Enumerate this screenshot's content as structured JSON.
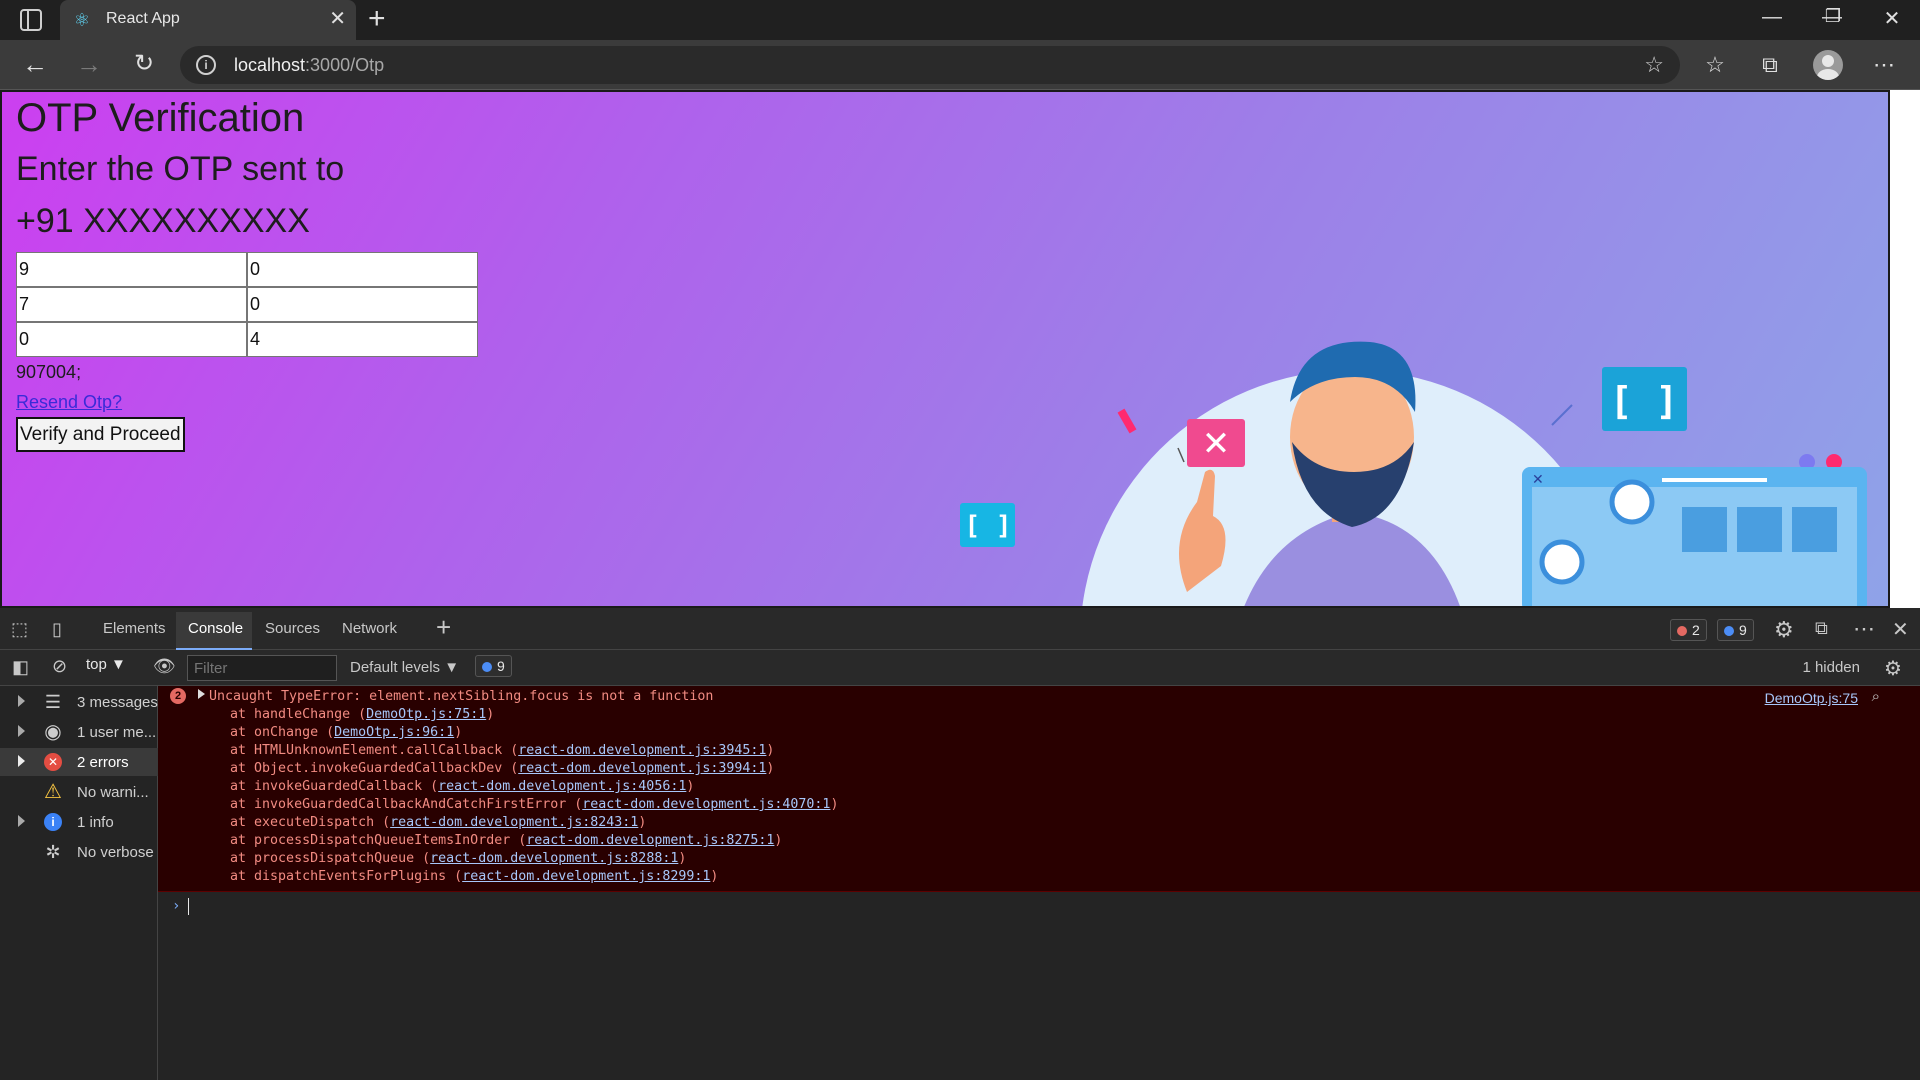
{
  "browser": {
    "tab_title": "React App",
    "url_host": "localhost",
    "url_rest": ":3000/Otp"
  },
  "page": {
    "heading": "OTP Verification",
    "subheading": "Enter the OTP sent to",
    "phone": "+91 XXXXXXXXXX",
    "otp_inputs": [
      "9",
      "0",
      "7",
      "0",
      "0",
      "4"
    ],
    "otp_value": "907004;",
    "resend_label": "Resend Otp?",
    "verify_label": "Verify and Proceed"
  },
  "devtools": {
    "tabs": [
      "Elements",
      "Console",
      "Sources",
      "Network"
    ],
    "active_tab": "Console",
    "error_count": "2",
    "info_count": "9",
    "context": "top",
    "filter_placeholder": "Filter",
    "levels_label": "Default levels",
    "issues_count": "9",
    "hidden_label": "1 hidden",
    "sidebar": [
      {
        "label": "3 messages",
        "icon": "list-icon"
      },
      {
        "label": "1 user me...",
        "icon": "user-icon"
      },
      {
        "label": "2 errors",
        "icon": "error-icon"
      },
      {
        "label": "No warni...",
        "icon": "warning-icon"
      },
      {
        "label": "1 info",
        "icon": "info-icon"
      },
      {
        "label": "No verbose",
        "icon": "bug-icon"
      }
    ],
    "error": {
      "count_badge": "2",
      "message": "Uncaught TypeError: element.nextSibling.focus is not a function",
      "source": "DemoOtp.js:75",
      "stack": [
        {
          "fn": "at handleChange (",
          "link": "DemoOtp.js:75:1"
        },
        {
          "fn": "at onChange (",
          "link": "DemoOtp.js:96:1"
        },
        {
          "fn": "at HTMLUnknownElement.callCallback (",
          "link": "react-dom.development.js:3945:1"
        },
        {
          "fn": "at Object.invokeGuardedCallbackDev (",
          "link": "react-dom.development.js:3994:1"
        },
        {
          "fn": "at invokeGuardedCallback (",
          "link": "react-dom.development.js:4056:1"
        },
        {
          "fn": "at invokeGuardedCallbackAndCatchFirstError (",
          "link": "react-dom.development.js:4070:1"
        },
        {
          "fn": "at executeDispatch (",
          "link": "react-dom.development.js:8243:1"
        },
        {
          "fn": "at processDispatchQueueItemsInOrder (",
          "link": "react-dom.development.js:8275:1"
        },
        {
          "fn": "at processDispatchQueue (",
          "link": "react-dom.development.js:8288:1"
        },
        {
          "fn": "at dispatchEventsForPlugins (",
          "link": "react-dom.development.js:8299:1"
        }
      ]
    }
  }
}
